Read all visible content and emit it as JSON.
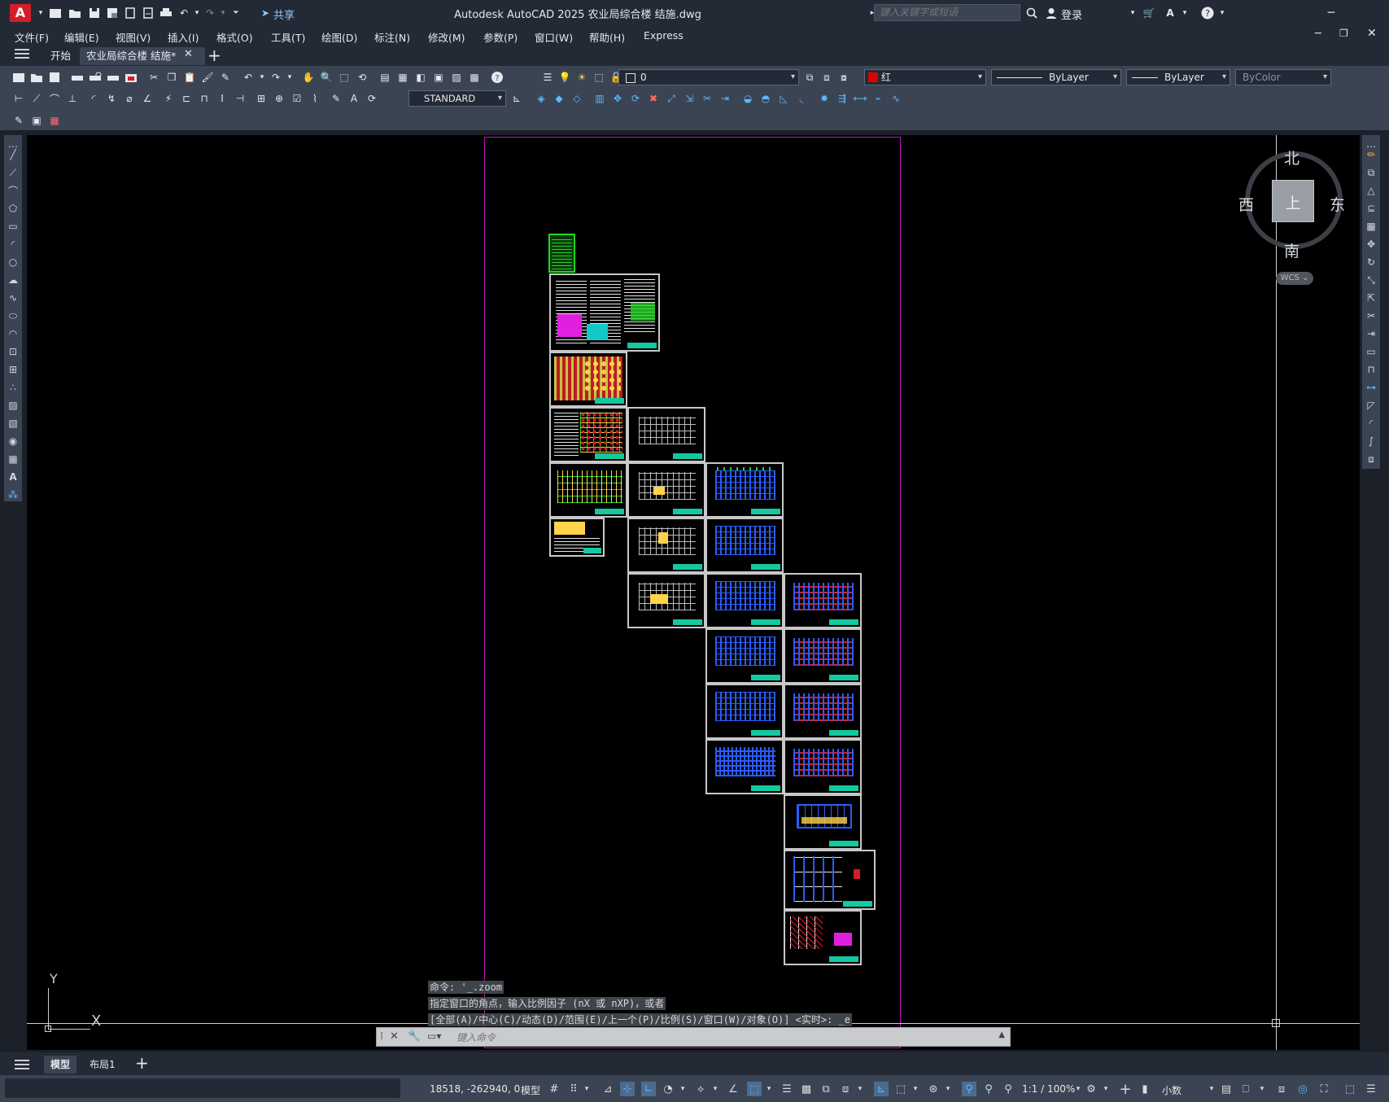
{
  "app": {
    "logo": "A",
    "title": "Autodesk AutoCAD 2025    农业局综合楼 结施.dwg",
    "share": "共享",
    "search_placeholder": "键入关键字或短语",
    "login": "登录"
  },
  "menu": [
    "文件(F)",
    "编辑(E)",
    "视图(V)",
    "插入(I)",
    "格式(O)",
    "工具(T)",
    "绘图(D)",
    "标注(N)",
    "修改(M)",
    "参数(P)",
    "窗口(W)",
    "帮助(H)",
    "Express"
  ],
  "tabs": {
    "start": "开始",
    "active": "农业局综合楼  结施*"
  },
  "properties": {
    "layer": "0",
    "color": "红",
    "linetype": "ByLayer",
    "lineweight": "ByLayer",
    "plotstyle": "ByColor",
    "dimstyle": "STANDARD"
  },
  "viewcube": {
    "north": "北",
    "south": "南",
    "east": "东",
    "west": "西",
    "top": "上",
    "wcs": "WCS"
  },
  "ucs": {
    "y": "Y",
    "x": "X"
  },
  "command": {
    "history": [
      "命令: '_.zoom",
      "指定窗口的角点，输入比例因子 (nX 或 nXP)，或者",
      "[全部(A)/中心(C)/动态(D)/范围(E)/上一个(P)/比例(S)/窗口(W)/对象(O)] <实时>: _e"
    ],
    "placeholder": "键入命令"
  },
  "layout_tabs": {
    "model": "模型",
    "layout1": "布局1"
  },
  "status": {
    "coords": "18518, -262940, 0",
    "space": "模型",
    "scale": "1:1 / 100%",
    "units": "小数"
  },
  "colors": {
    "canvas": "#000000",
    "viewport_frame": "#c018c0",
    "titleblock": "#14c8a0",
    "accent": "#5cb8ff",
    "logo": "#d41d2a"
  }
}
